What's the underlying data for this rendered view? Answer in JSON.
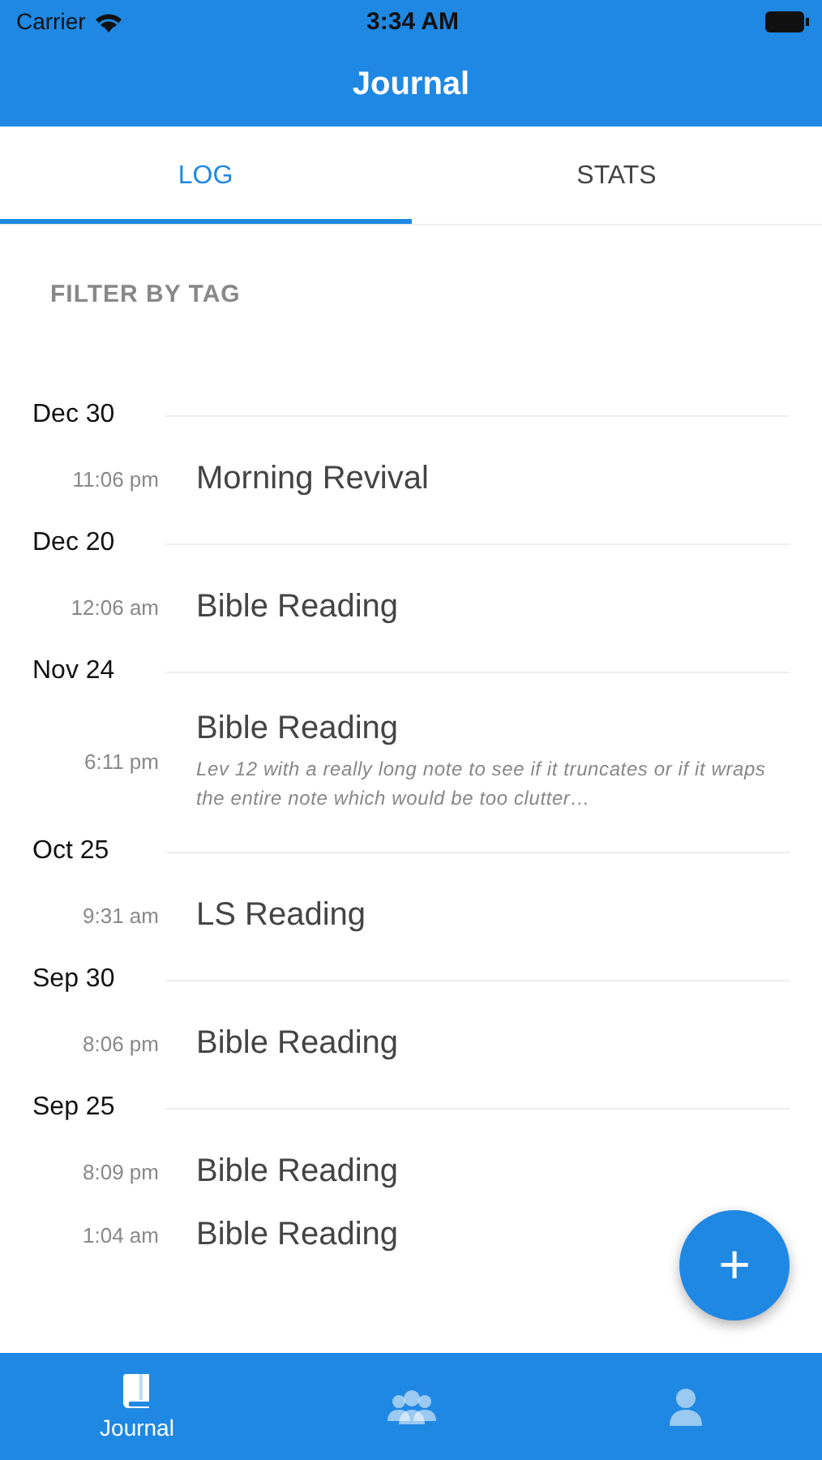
{
  "status_bar": {
    "carrier": "Carrier",
    "time": "3:34 AM"
  },
  "header": {
    "title": "Journal"
  },
  "tabs": [
    {
      "label": "LOG",
      "selected": true
    },
    {
      "label": "STATS",
      "selected": false
    }
  ],
  "filter": {
    "label": "FILTER BY TAG"
  },
  "groups": [
    {
      "date": "Dec 30",
      "entries": [
        {
          "time": "11:06 pm",
          "title": "Morning Revival"
        }
      ]
    },
    {
      "date": "Dec 20",
      "entries": [
        {
          "time": "12:06 am",
          "title": "Bible Reading"
        }
      ]
    },
    {
      "date": "Nov 24",
      "entries": [
        {
          "time": "6:11 pm",
          "title": "Bible Reading",
          "note": "Lev 12 with a really long note to see if it truncates or if it wraps the entire note which would be too clutter…"
        }
      ]
    },
    {
      "date": "Oct 25",
      "entries": [
        {
          "time": "9:31 am",
          "title": "LS Reading"
        }
      ]
    },
    {
      "date": "Sep 30",
      "entries": [
        {
          "time": "8:06 pm",
          "title": "Bible Reading"
        }
      ]
    },
    {
      "date": "Sep 25",
      "entries": [
        {
          "time": "8:09 pm",
          "title": "Bible Reading"
        },
        {
          "time": "1:04 am",
          "title": "Bible Reading"
        }
      ]
    }
  ],
  "fab": {
    "label": "+"
  },
  "bottom_tabs": [
    {
      "kind": "book",
      "label": "Journal",
      "selected": true
    },
    {
      "kind": "group",
      "selected": false
    },
    {
      "kind": "person",
      "selected": false
    }
  ]
}
